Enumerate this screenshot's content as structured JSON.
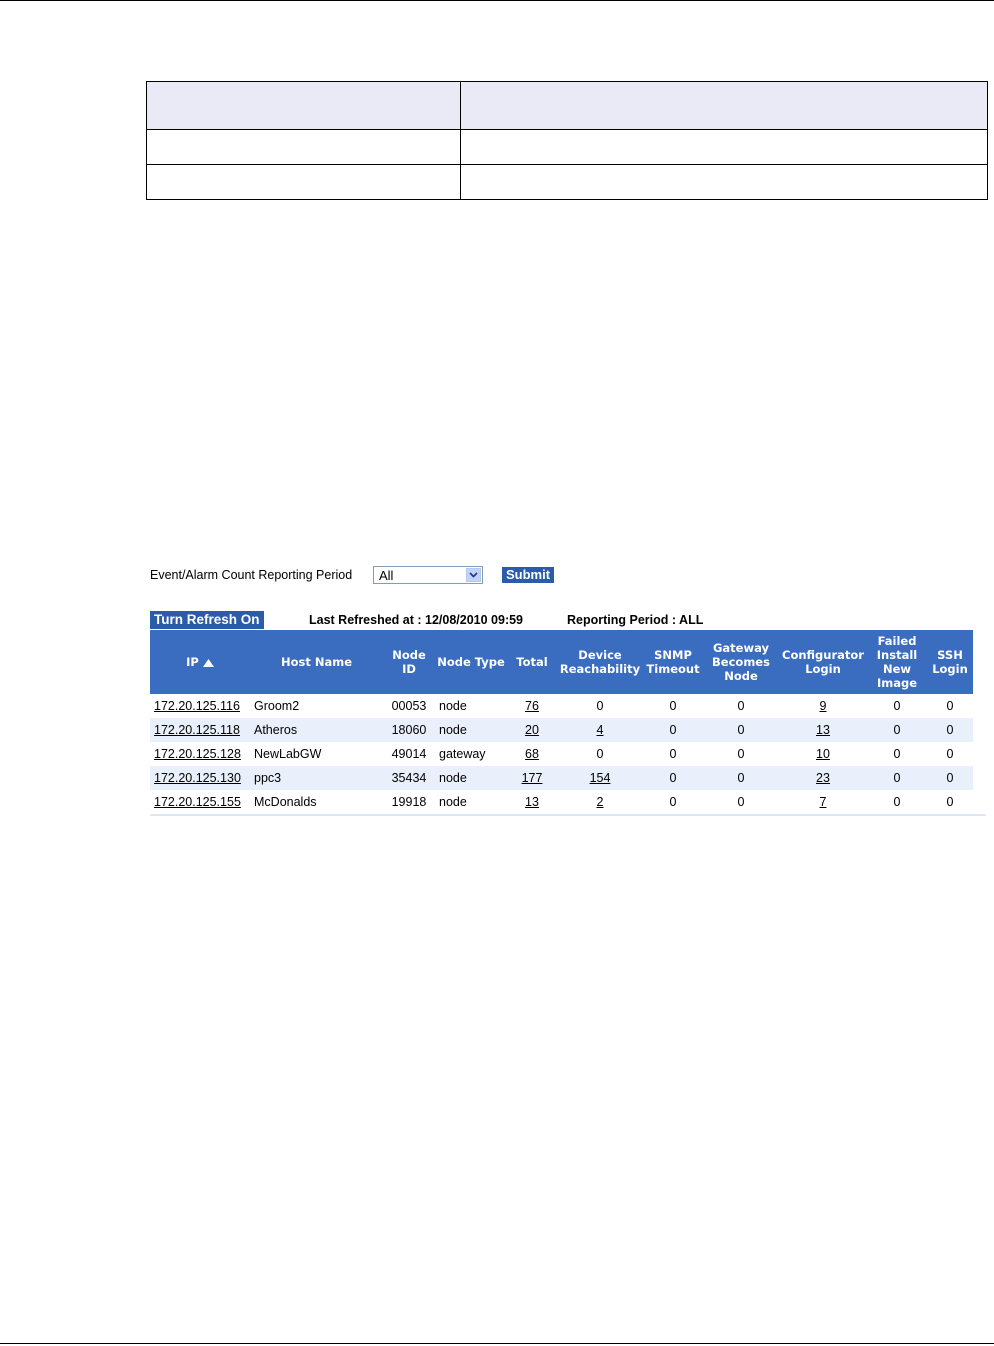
{
  "controls": {
    "period_label": "Event/Alarm Count Reporting Period",
    "period_value": "All",
    "submit_label": "Submit",
    "refresh_label": "Turn Refresh On",
    "last_refreshed": "Last Refreshed at : 12/08/2010 09:59",
    "reporting_period": "Reporting Period : ALL"
  },
  "icons": {
    "sort": "triangle-up-icon",
    "dropdown": "chevron-down-icon"
  },
  "colors": {
    "header_bg": "#3a6cc0",
    "button_bg": "#2a5caa",
    "alt_row_bg": "#eaf0fb",
    "doc_header_bg": "#eaeaf7"
  },
  "table": {
    "headers": {
      "ip": "IP",
      "host": "Host Name",
      "node_id": "Node ID",
      "node_type": "Node Type",
      "total": "Total",
      "device": "Device Reachability",
      "snmp": "SNMP Timeout",
      "gateway": "Gateway Becomes Node",
      "config": "Configurator Login",
      "failed": "Failed Install New Image",
      "ssh": "SSH Login"
    },
    "rows": [
      {
        "ip": "172.20.125.116",
        "host": "Groom2",
        "node_id": "00053",
        "node_type": "node",
        "total": "76",
        "device": "0",
        "snmp": "0",
        "gateway": "0",
        "config": "9",
        "failed": "0",
        "ssh": "0"
      },
      {
        "ip": "172.20.125.118",
        "host": "Atheros",
        "node_id": "18060",
        "node_type": "node",
        "total": "20",
        "device": "4",
        "snmp": "0",
        "gateway": "0",
        "config": "13",
        "failed": "0",
        "ssh": "0"
      },
      {
        "ip": "172.20.125.128",
        "host": "NewLabGW",
        "node_id": "49014",
        "node_type": "gateway",
        "total": "68",
        "device": "0",
        "snmp": "0",
        "gateway": "0",
        "config": "10",
        "failed": "0",
        "ssh": "0"
      },
      {
        "ip": "172.20.125.130",
        "host": "ppc3",
        "node_id": "35434",
        "node_type": "node",
        "total": "177",
        "device": "154",
        "snmp": "0",
        "gateway": "0",
        "config": "23",
        "failed": "0",
        "ssh": "0"
      },
      {
        "ip": "172.20.125.155",
        "host": "McDonalds",
        "node_id": "19918",
        "node_type": "node",
        "total": "13",
        "device": "2",
        "snmp": "0",
        "gateway": "0",
        "config": "7",
        "failed": "0",
        "ssh": "0"
      }
    ]
  }
}
